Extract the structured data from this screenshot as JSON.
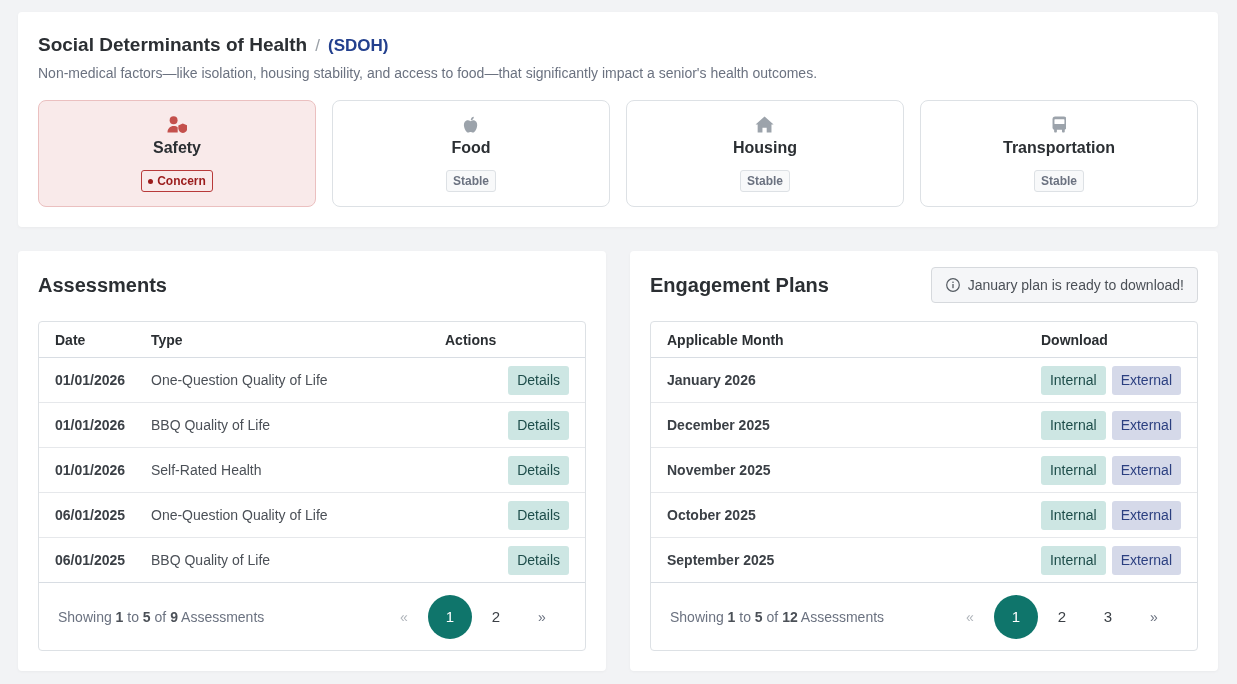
{
  "overview": {
    "title": "Social Determinants of Health",
    "separator": "/",
    "abbreviation": "(SDOH)",
    "description": "Non-medical factors—like isolation, housing stability, and access to food—that significantly impact a senior's health outcomes.",
    "categories": [
      {
        "label": "Safety",
        "status": "Concern",
        "flagged": true
      },
      {
        "label": "Food",
        "status": "Stable",
        "flagged": false
      },
      {
        "label": "Housing",
        "status": "Stable",
        "flagged": false
      },
      {
        "label": "Transportation",
        "status": "Stable",
        "flagged": false
      }
    ]
  },
  "assessments": {
    "title": "Assessments",
    "table": {
      "columns": [
        "Date",
        "Type",
        "Actions"
      ],
      "rows": [
        {
          "cells": [
            "01/01/2026",
            "One-Question Quality of Life"
          ],
          "actions": [
            {
              "label": "Details",
              "kind": "details"
            }
          ]
        },
        {
          "cells": [
            "01/01/2026",
            "BBQ Quality of Life"
          ],
          "actions": [
            {
              "label": "Details",
              "kind": "details"
            }
          ]
        },
        {
          "cells": [
            "01/01/2026",
            "Self-Rated Health"
          ],
          "actions": [
            {
              "label": "Details",
              "kind": "details"
            }
          ]
        },
        {
          "cells": [
            "06/01/2025",
            "One-Question Quality of Life"
          ],
          "actions": [
            {
              "label": "Details",
              "kind": "details"
            }
          ]
        },
        {
          "cells": [
            "06/01/2025",
            "BBQ Quality of Life"
          ],
          "actions": [
            {
              "label": "Details",
              "kind": "details"
            }
          ]
        }
      ]
    },
    "footer": {
      "summary": "Showing **1** to **5** of **9** Assessments",
      "pagination": {
        "previous": {
          "label": "«",
          "disabled": true
        },
        "pages": [
          {
            "label": "1",
            "selected": true
          },
          {
            "label": "2",
            "selected": false
          }
        ],
        "next": {
          "label": "»",
          "disabled": false
        }
      }
    }
  },
  "engagement_plans": {
    "title": "Engagement Plans",
    "notice": {
      "text": "January plan is ready to download!"
    },
    "table": {
      "columns": [
        "Applicable Month",
        "Download"
      ],
      "rows": [
        {
          "cells": [
            "January 2026"
          ],
          "actions": [
            {
              "label": "Internal",
              "kind": "internal"
            },
            {
              "label": "External",
              "kind": "external"
            }
          ]
        },
        {
          "cells": [
            "December 2025"
          ],
          "actions": [
            {
              "label": "Internal",
              "kind": "internal"
            },
            {
              "label": "External",
              "kind": "external"
            }
          ]
        },
        {
          "cells": [
            "November 2025"
          ],
          "actions": [
            {
              "label": "Internal",
              "kind": "internal"
            },
            {
              "label": "External",
              "kind": "external"
            }
          ]
        },
        {
          "cells": [
            "October 2025"
          ],
          "actions": [
            {
              "label": "Internal",
              "kind": "internal"
            },
            {
              "label": "External",
              "kind": "external"
            }
          ]
        },
        {
          "cells": [
            "September 2025"
          ],
          "actions": [
            {
              "label": "Internal",
              "kind": "internal"
            },
            {
              "label": "External",
              "kind": "external"
            }
          ]
        }
      ]
    },
    "footer": {
      "summary": "Showing **1** to **5** of **12** Assessments",
      "pagination": {
        "previous": {
          "label": "«",
          "disabled": true
        },
        "pages": [
          {
            "label": "1",
            "selected": true
          },
          {
            "label": "2",
            "selected": false
          },
          {
            "label": "3",
            "selected": false
          }
        ],
        "next": {
          "label": "»",
          "disabled": false
        }
      }
    }
  }
}
